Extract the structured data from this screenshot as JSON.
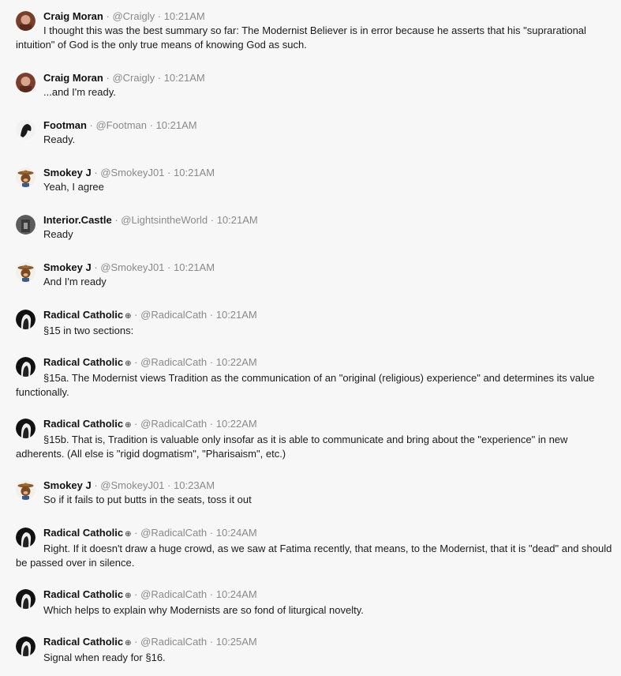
{
  "separator": "·",
  "messages": [
    {
      "name": "Craig Moran",
      "badge": "",
      "handle": "@Craigly",
      "time": "10:21AM",
      "avatar": "craig-avatar-icon",
      "text": "I thought this was the best summary so far: The Modernist Believer is in error because he asserts that his \"suprarational intuition\" of God is the only true means of knowing God as such."
    },
    {
      "name": "Craig Moran",
      "badge": "",
      "handle": "@Craigly",
      "time": "10:21AM",
      "avatar": "craig-avatar-icon",
      "text": "...and I'm ready."
    },
    {
      "name": "Footman",
      "badge": "",
      "handle": "@Footman",
      "time": "10:21AM",
      "avatar": "footman-avatar-icon",
      "text": "Ready."
    },
    {
      "name": "Smokey J",
      "badge": "",
      "handle": "@SmokeyJ01",
      "time": "10:21AM",
      "avatar": "smokey-bear-avatar-icon",
      "text": "Yeah, I agree"
    },
    {
      "name": "Interior.Castle",
      "badge": "",
      "handle": "@LightsintheWorld",
      "time": "10:21AM",
      "avatar": "castle-avatar-icon",
      "text": "Ready"
    },
    {
      "name": "Smokey J",
      "badge": "",
      "handle": "@SmokeyJ01",
      "time": "10:21AM",
      "avatar": "smokey-bear-avatar-icon",
      "text": "And I'm ready"
    },
    {
      "name": "Radical Catholic",
      "badge": "⊕",
      "handle": "@RadicalCath",
      "time": "10:21AM",
      "avatar": "radical-catholic-avatar-icon",
      "text": "§15 in two sections:"
    },
    {
      "name": "Radical Catholic",
      "badge": "⊕",
      "handle": "@RadicalCath",
      "time": "10:22AM",
      "avatar": "radical-catholic-avatar-icon",
      "text": "§15a. The Modernist views Tradition as the communication of an \"original (religious) experience\" and determines its value functionally."
    },
    {
      "name": "Radical Catholic",
      "badge": "⊕",
      "handle": "@RadicalCath",
      "time": "10:22AM",
      "avatar": "radical-catholic-avatar-icon",
      "text": "§15b. That is, Tradition is valuable only insofar as it is able to communicate and bring about the \"experience\" in new adherents. (All else is \"rigid dogmatism\", \"Pharisaism\", etc.)"
    },
    {
      "name": "Smokey J",
      "badge": "",
      "handle": "@SmokeyJ01",
      "time": "10:23AM",
      "avatar": "smokey-bear-avatar-icon",
      "text": "So if it fails to put butts in the seats, toss it out"
    },
    {
      "name": "Radical Catholic",
      "badge": "⊕",
      "handle": "@RadicalCath",
      "time": "10:24AM",
      "avatar": "radical-catholic-avatar-icon",
      "text": "Right. If it doesn't draw a huge crowd, as we saw at Fatima recently, that means, to the Modernist, that it is \"dead\" and should be passed over in silence."
    },
    {
      "name": "Radical Catholic",
      "badge": "⊕",
      "handle": "@RadicalCath",
      "time": "10:24AM",
      "avatar": "radical-catholic-avatar-icon",
      "text": "Which helps to explain why Modernists are so fond of liturgical novelty."
    },
    {
      "name": "Radical Catholic",
      "badge": "⊕",
      "handle": "@RadicalCath",
      "time": "10:25AM",
      "avatar": "radical-catholic-avatar-icon",
      "text": "Signal when ready for §16."
    }
  ]
}
